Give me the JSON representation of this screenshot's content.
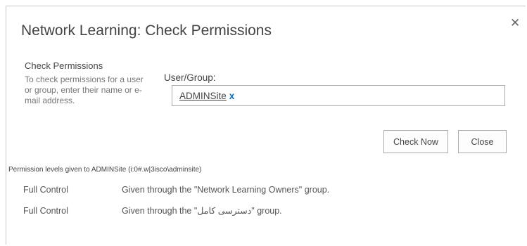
{
  "dialog": {
    "title": "Network Learning: Check Permissions",
    "close_icon": "close-icon"
  },
  "check_section": {
    "heading": "Check Permissions",
    "description": "To check permissions for a user or group, enter their name or e-mail address."
  },
  "user_field": {
    "label": "User/Group:",
    "entity": "ADMINSite",
    "remove_label": "x"
  },
  "buttons": {
    "check_now": "Check Now",
    "close": "Close"
  },
  "results": {
    "heading": "Permission levels given to ADMINSite (i:0#.w|3isco\\adminsite)",
    "rows": [
      {
        "level": "Full Control",
        "detail": "Given through the \"Network Learning Owners\" group."
      },
      {
        "level": "Full Control",
        "detail": "Given through the \"دسترسی کامل\" group."
      }
    ]
  }
}
